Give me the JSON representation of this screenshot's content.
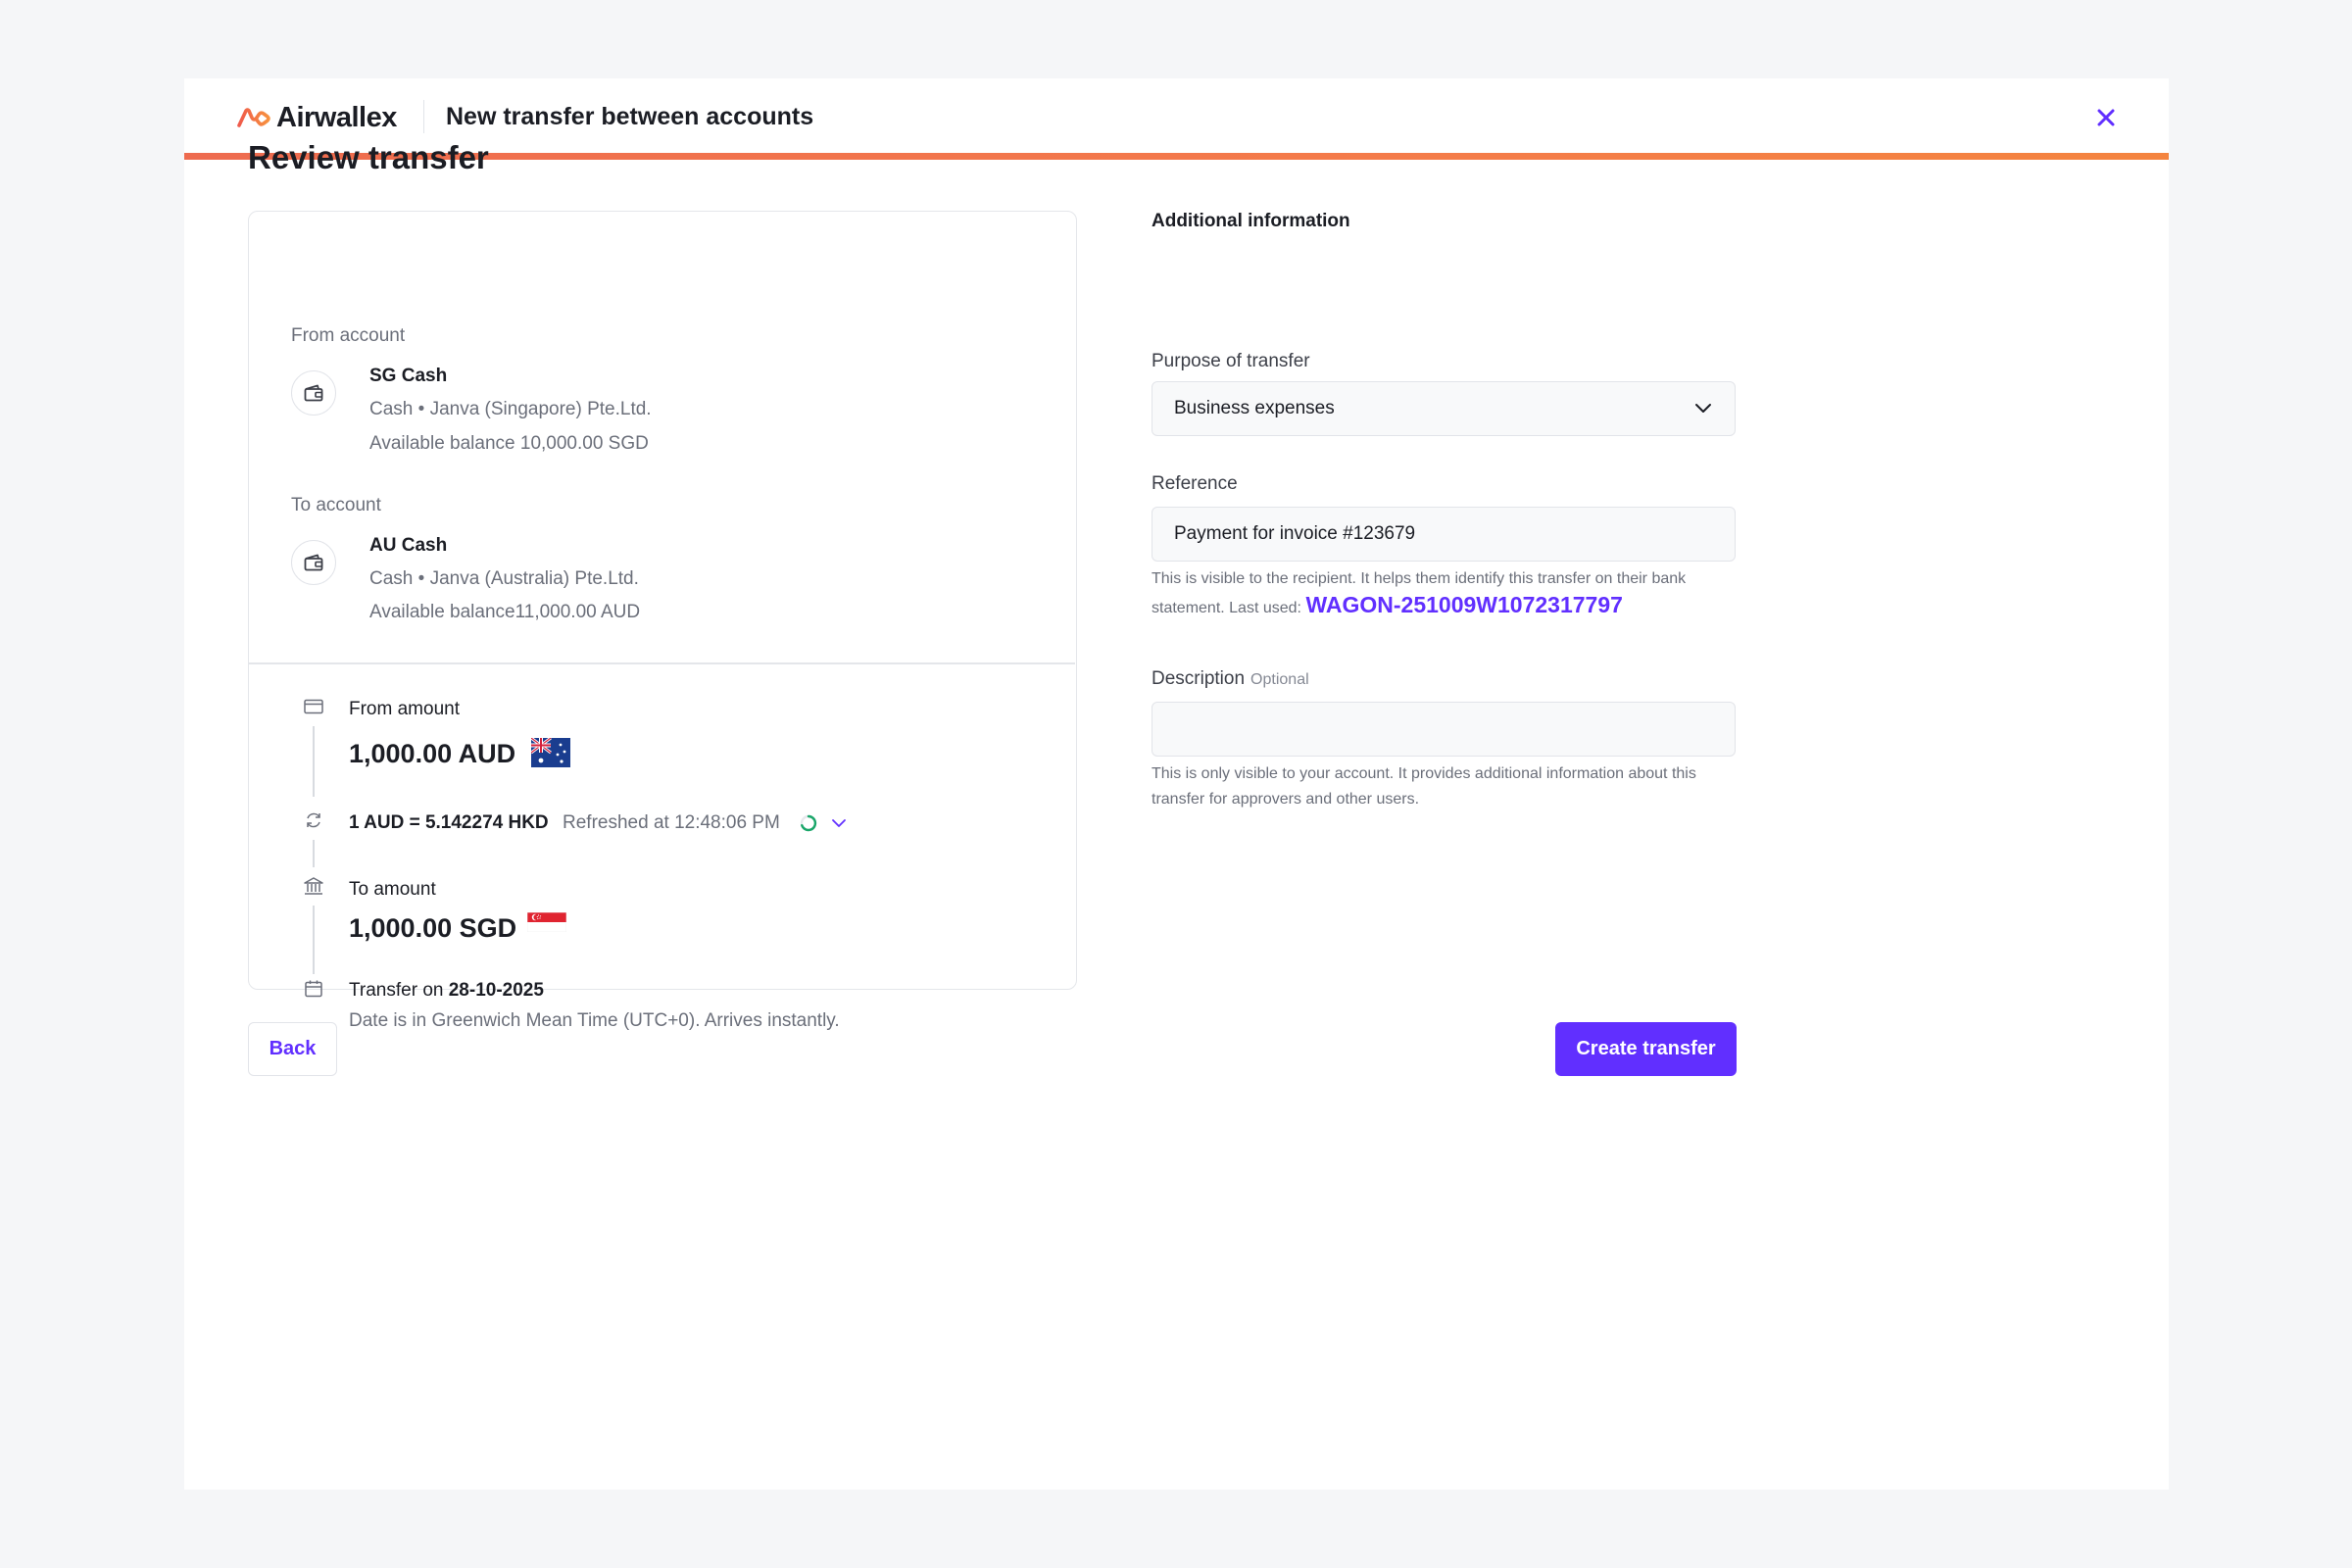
{
  "header": {
    "brand": "Airwallex",
    "title": "New transfer between accounts",
    "close_icon": "close-icon",
    "accent_color": "#612fff",
    "bar_color": "#f47b4a"
  },
  "page": {
    "title": "Review transfer"
  },
  "from_account": {
    "label": "From account",
    "name": "SG Cash",
    "details": "Cash • Janva (Singapore) Pte.Ltd.",
    "balance": "Available balance 10,000.00 SGD",
    "icon": "wallet-icon"
  },
  "to_account": {
    "label": "To account",
    "name": "AU Cash",
    "details": "Cash • Janva (Australia) Pte.Ltd.",
    "balance": "Available balance11,000.00 AUD",
    "icon": "wallet-icon"
  },
  "summary": {
    "from_amount_label": "From amount",
    "from_amount": "1,000.00 AUD",
    "rate": "1 AUD = 5.142274 HKD",
    "refreshed": "Refreshed at 12:48:06 PM",
    "to_amount_label": "To amount",
    "to_amount": "1,000.00 SGD",
    "transfer_on_prefix": "Transfer on",
    "transfer_date": "28-10-2025",
    "date_note": "Date is in Greenwich Mean Time (UTC+0). Arrives instantly."
  },
  "additional": {
    "heading": "Additional information",
    "purpose_label": "Purpose of transfer",
    "purpose_value": "Business expenses",
    "reference_label": "Reference",
    "reference_value": "Payment for invoice #123679",
    "reference_help_1": "This is visible to the recipient. It helps them identify this transfer on their bank statement. Last used:",
    "reference_last_used": "WAGON-251009W1072317797",
    "description_label": "Description",
    "description_optional": "Optional",
    "description_value": "",
    "description_help": "This is only visible to your account. It provides additional information about this transfer for approvers and other users."
  },
  "actions": {
    "back_label": "Back",
    "create_label": "Create transfer"
  }
}
